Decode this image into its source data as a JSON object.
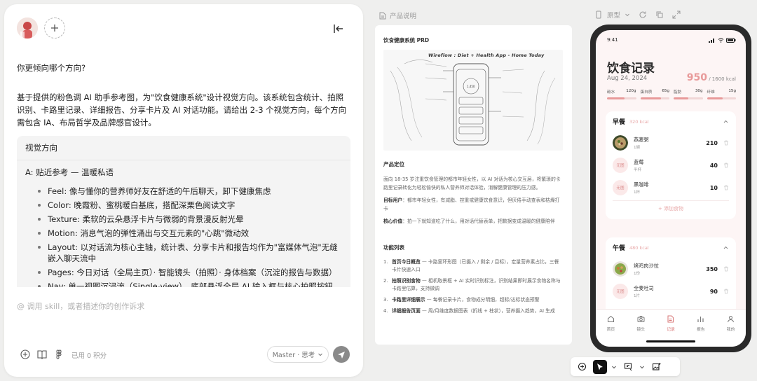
{
  "chat": {
    "question": "你更倾向哪个方向?",
    "description": "基于提供的粉色调 AI 助手参考图，为\"饮食健康系统\"设计视觉方向。该系统包含统计、拍照识别、卡路里记录、详细报告、分享卡片及 AI 对话功能。请给出 2-3 个视觉方向，每个方向需包含 IA、布局哲学及品牌感官设计。",
    "card_header": "视觉方向",
    "section_title": "A: 贴近参考 — 温暖私语",
    "bullets": [
      "Feel: 像与懂你的营养师好友在舒适的午后聊天，卸下健康焦虑",
      "Color: 晚霞粉、蜜桃暖白基底，搭配深栗色阅读文字",
      "Texture: 柔软的云朵悬浮卡片与微弱的背景漫反射光晕",
      "Motion: 消息气泡的弹性涌出与交互元素的\"心跳\"微动效",
      "Layout: 以对话流为核心主轴，统计表、分享卡片和报告均作为\"富媒体气泡\"无缝嵌入聊天流中",
      "Pages: 今日对话（全局主页）· 智能镜头（拍照）· 身体档案（沉淀的报告与数据）",
      "Nav: 单一视图沉浸流（Single-view），底部悬浮全局 AI 输入框与核心拍照按钮"
    ],
    "input_placeholder": "@ 调用 skill，或者描述你的创作诉求",
    "credits": "已用 0 积分",
    "model": "Master · 思考"
  },
  "doc": {
    "tab_label": "产品说明",
    "title": "饮食健康系统 PRD",
    "sketch_title": "Wireflow : Diet + Health App - Home Today",
    "positioning_h": "产品定位",
    "positioning_p": "面向 18-35 岁注重饮食管理的都市年轻女性，以 AI 对话为核心交互层，将繁琐的卡路里记录转化为轻松愉快的私人营养师对话体验，消解健康管理的压力感。",
    "target_label": "目标用户",
    "target_text": "：都市年轻女性，有减脂、控重或健康饮食意识，但厌倦手动查表和枯燥打卡",
    "value_label": "核心价值",
    "value_text": "：拍一下就知道吃了什么，用对话代替表单，把数据变成温暖的健康陪伴",
    "features_h": "功能列表",
    "features": [
      {
        "n": "1.",
        "name": "首页今日概览",
        "text": " — 卡路里环形图（已摄入 / 剩余 / 目标），宏量营养素占比，三餐卡片快速入口"
      },
      {
        "n": "2.",
        "name": "拍照识别食物",
        "text": " — 相机取景框 + AI 实时识别标注，识别结果即时展示食物名称与卡路里估算，支持微调"
      },
      {
        "n": "3.",
        "name": "卡路里详细展示",
        "text": " — 每餐记录卡片，食物成分明细，超标/达标状态预警"
      },
      {
        "n": "4.",
        "name": "详细报告页面",
        "text": " — 周/月维度数据图表（折线 + 柱状），营养摄入趋势，AI 生成"
      }
    ]
  },
  "proto": {
    "mode_label": "原型"
  },
  "app": {
    "time": "9:41",
    "title": "饮食记录",
    "date": "Aug 24, 2024",
    "kcal_value": "950",
    "kcal_target": " / 1600 kcal",
    "macros": [
      {
        "name": "碳水",
        "value": "120g",
        "fill": 0.6
      },
      {
        "name": "蛋白质",
        "value": "65g",
        "fill": 0.7
      },
      {
        "name": "脂肪",
        "value": "30g",
        "fill": 0.5
      },
      {
        "name": "纤维",
        "value": "15g",
        "fill": 0.55
      }
    ],
    "breakfast": {
      "name": "早餐",
      "kcal": "320 kcal",
      "items": [
        {
          "name": "燕麦粥",
          "qty": "1碗",
          "value": "210",
          "thumb": "bowl"
        },
        {
          "name": "蓝莓",
          "qty": "半杯",
          "value": "40",
          "thumb": "none"
        },
        {
          "name": "黑咖啡",
          "qty": "1杯",
          "value": "10",
          "thumb": "none"
        }
      ],
      "add_label": "+ 添加食物"
    },
    "lunch": {
      "name": "午餐",
      "kcal": "480 kcal",
      "items": [
        {
          "name": "烤鸡肉沙拉",
          "qty": "1份",
          "value": "350",
          "thumb": "salad"
        },
        {
          "name": "全麦吐司",
          "qty": "1片",
          "value": "90",
          "thumb": "none"
        }
      ]
    },
    "no_image": "无图",
    "tabs": [
      {
        "label": "首页",
        "icon": "home-icon"
      },
      {
        "label": "镜头",
        "icon": "camera-icon"
      },
      {
        "label": "记录",
        "icon": "document-icon",
        "active": true
      },
      {
        "label": "报告",
        "icon": "bar-chart-icon"
      },
      {
        "label": "我的",
        "icon": "user-icon"
      }
    ],
    "accent": "#e89a9a"
  }
}
